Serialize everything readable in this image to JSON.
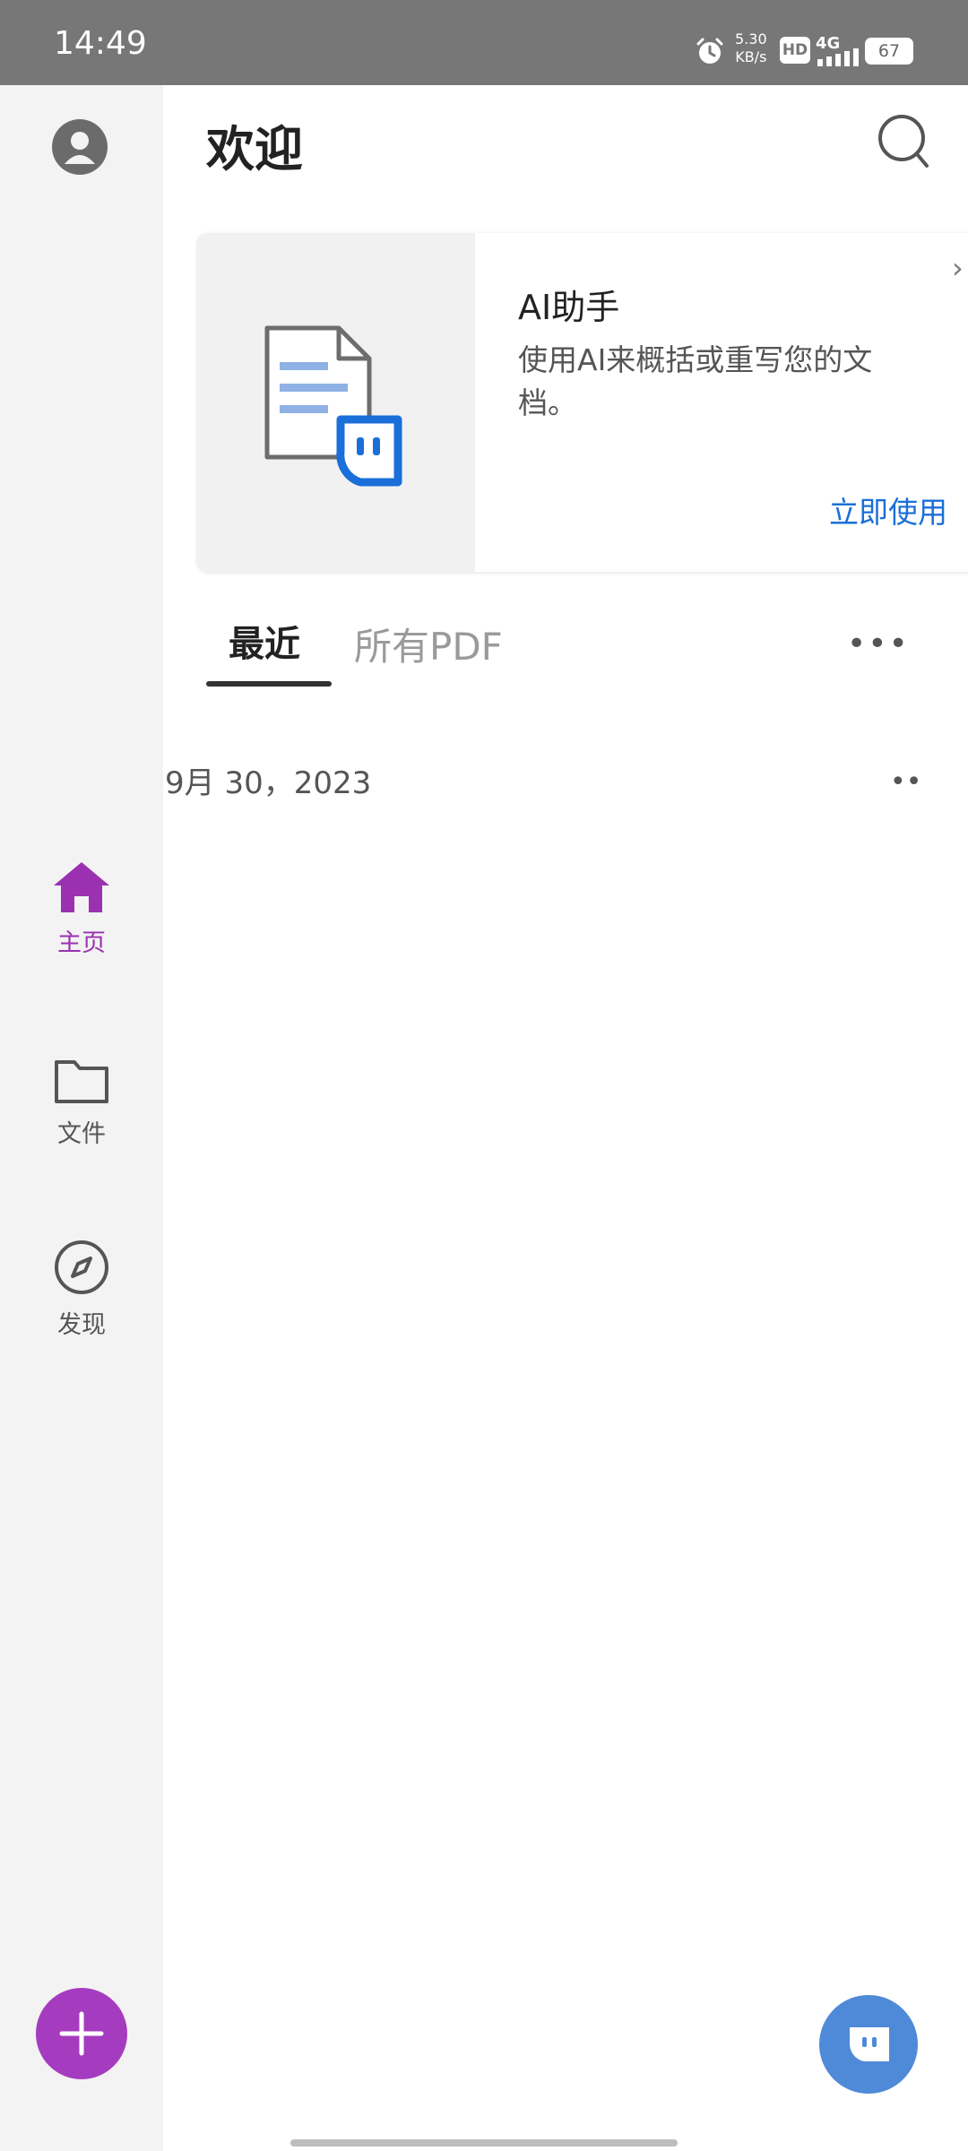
{
  "status_bar": {
    "time": "14:49",
    "network_speed": "5.30",
    "network_speed_unit": "KB/s",
    "hd_badge": "HD",
    "network_type": "4G",
    "battery": "67"
  },
  "header": {
    "title": "欢迎"
  },
  "ai_card": {
    "title": "AI助手",
    "description": "使用AI来概括或重写您的文档。",
    "action_label": "立即使用"
  },
  "tabs": [
    {
      "label": "最近",
      "active": true
    },
    {
      "label": "所有PDF",
      "active": false
    }
  ],
  "recent": {
    "date_header": "9月 30，2023"
  },
  "sidebar": {
    "items": [
      {
        "label": "主页",
        "icon": "home-icon",
        "active": true
      },
      {
        "label": "文件",
        "icon": "folder-icon",
        "active": false
      },
      {
        "label": "发现",
        "icon": "compass-icon",
        "active": false
      }
    ]
  },
  "colors": {
    "accent_purple": "#a53cbf",
    "link_blue": "#1a6fd8",
    "ai_fab_blue": "#4f8ad8",
    "status_bar": "#777777",
    "sidebar_bg": "#f3f3f3"
  }
}
